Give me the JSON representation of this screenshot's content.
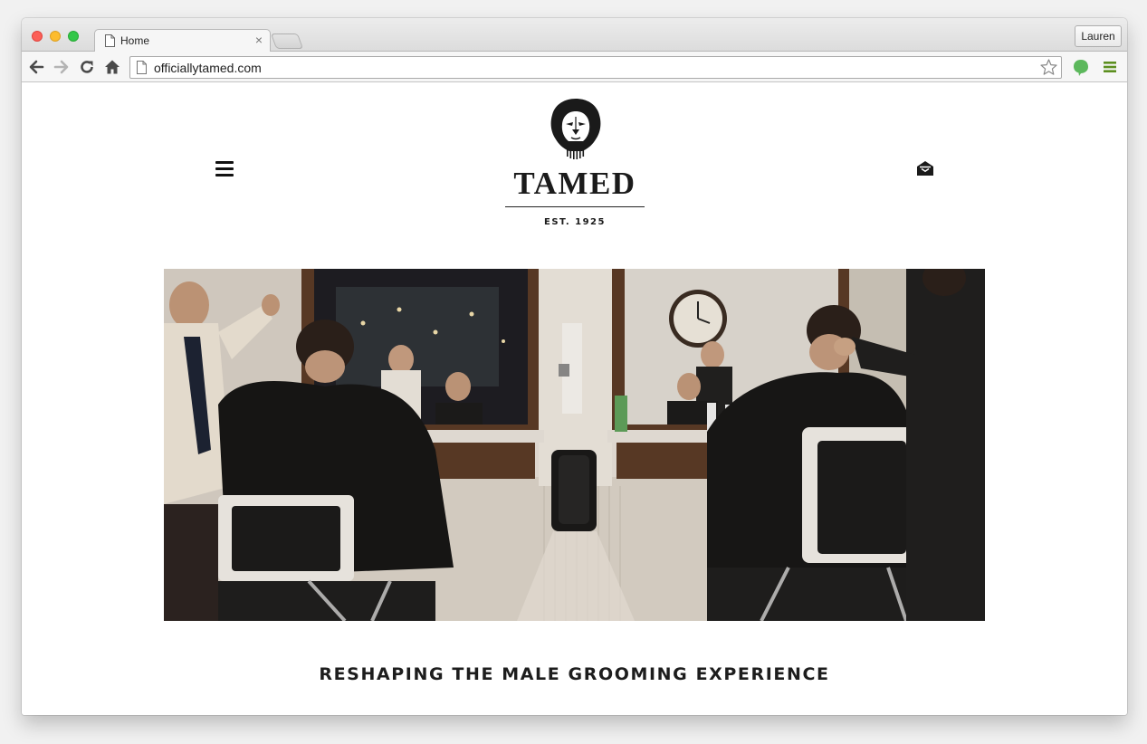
{
  "browser": {
    "tab_title": "Home",
    "tab_close": "×",
    "profile_name": "Lauren",
    "url": "officiallytamed.com",
    "icons": [
      "back-icon",
      "forward-icon",
      "reload-icon",
      "home-icon",
      "page-icon",
      "star-icon",
      "evernote-icon",
      "menu-icon"
    ],
    "colors": {
      "close": "#fc5f57",
      "minimize": "#fdbc2e",
      "maximize": "#33c748",
      "extension_green": "#5cb85c"
    }
  },
  "site": {
    "brand": "TAMED",
    "established": "EST. 1925",
    "tagline": "RESHAPING THE MALE GROOMING EXPERIENCE",
    "icons": [
      "hamburger-menu-icon",
      "lion-logo",
      "mail-icon"
    ],
    "hero_alt": "barbershop-photo"
  }
}
